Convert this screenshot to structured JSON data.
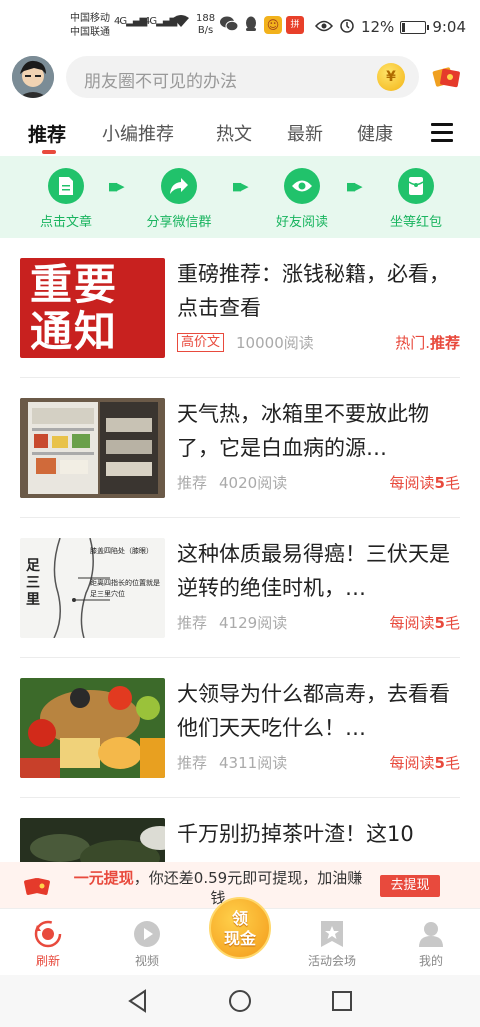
{
  "status_bar": {
    "carrier1": "中国移动",
    "carrier2": "中国联通",
    "net1": "4G",
    "net2": "4G",
    "speed_value": "188",
    "speed_unit": "B/s",
    "app_icon_label": "拼",
    "battery_percent": "12%",
    "battery_level": 0.12,
    "time": "9:04"
  },
  "header": {
    "search_placeholder": "朋友圈不可见的办法",
    "coin_symbol": "¥"
  },
  "tabs": [
    {
      "label": "推荐",
      "active": true
    },
    {
      "label": "小编推荐"
    },
    {
      "label": "热文"
    },
    {
      "label": "最新"
    },
    {
      "label": "健康"
    }
  ],
  "steps": [
    {
      "label": "点击文章",
      "icon": "document-icon"
    },
    {
      "label": "分享微信群",
      "icon": "share-icon"
    },
    {
      "label": "好友阅读",
      "icon": "eye-icon"
    },
    {
      "label": "坐等红包",
      "icon": "red-packet-icon"
    }
  ],
  "articles": [
    {
      "title": "重磅推荐：涨钱秘籍，必看，点击查看",
      "thumb_text_1": "重要",
      "thumb_text_2": "通知",
      "tag": "高价文",
      "reads": "10000阅读",
      "reward_prefix": "热门.",
      "reward_bold": "推荐",
      "reward_suffix": ""
    },
    {
      "title": "天气热，冰箱里不要放此物了，它是白血病的源…",
      "tag": "推荐",
      "reads": "4020阅读",
      "reward_prefix": "每阅读",
      "reward_bold": "5",
      "reward_suffix": "毛"
    },
    {
      "title": "这种体质最易得癌！三伏天是逆转的绝佳时机，…",
      "thumb_text_1": "足三里",
      "thumb_text_2": "膝盖四陷处（膝眼）",
      "thumb_text_3": "距离四指长的位置就是足三里穴位",
      "tag": "推荐",
      "reads": "4129阅读",
      "reward_prefix": "每阅读",
      "reward_bold": "5",
      "reward_suffix": "毛"
    },
    {
      "title": "大领导为什么都高寿，去看看他们天天吃什么！…",
      "tag": "推荐",
      "reads": "4311阅读",
      "reward_prefix": "每阅读",
      "reward_bold": "5",
      "reward_suffix": "毛"
    },
    {
      "title": "千万别扔掉茶叶渣！这10"
    }
  ],
  "withdraw": {
    "highlight": "一元提现",
    "text": "，你还差0.59元即可提现，加油赚钱",
    "button": "去提现"
  },
  "bottom_nav": {
    "items": [
      {
        "label": "刷新",
        "icon": "refresh-icon",
        "active": true
      },
      {
        "label": "视频",
        "icon": "play-icon"
      },
      {
        "label": "活动会场",
        "icon": "bookmark-star-icon"
      },
      {
        "label": "我的",
        "icon": "person-icon"
      }
    ],
    "cash_line1": "领",
    "cash_line2": "现金"
  },
  "colors": {
    "accent": "#e84a3d",
    "green": "#21c26b",
    "banner_bg": "#e7f8ee"
  }
}
